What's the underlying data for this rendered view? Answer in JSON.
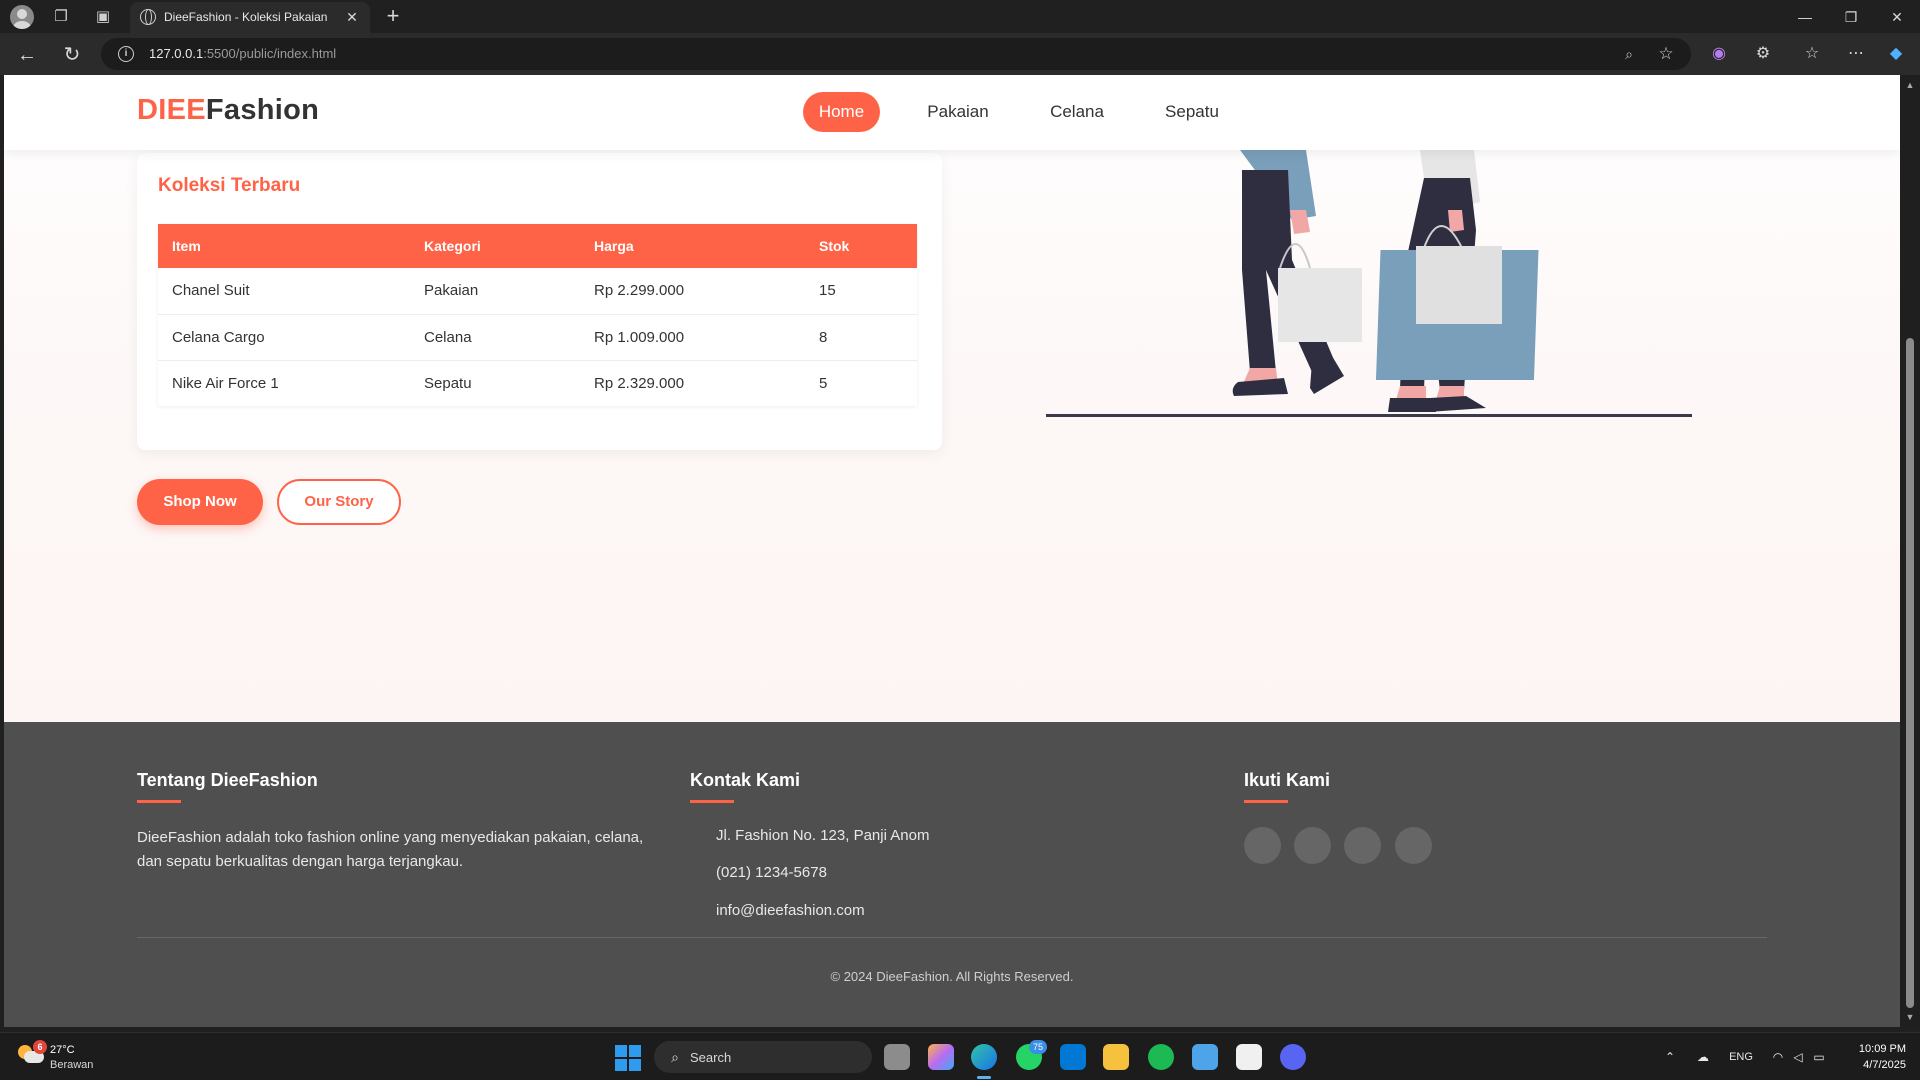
{
  "browser": {
    "tab_title": "DieeFashion - Koleksi Pakaian",
    "url_host": "127.0.0.1",
    "url_rest": ":5500/public/index.html"
  },
  "site": {
    "logo_accent": "DIEE",
    "logo_rest": "Fashion",
    "accent_color": "#ff6347",
    "nav": [
      "Home",
      "Pakaian",
      "Celana",
      "Sepatu"
    ],
    "nav_active": "Home"
  },
  "collection": {
    "title": "Koleksi Terbaru",
    "columns": [
      "Item",
      "Kategori",
      "Harga",
      "Stok"
    ],
    "rows": [
      [
        "Chanel Suit",
        "Pakaian",
        "Rp 2.299.000",
        "15"
      ],
      [
        "Celana Cargo",
        "Celana",
        "Rp 1.009.000",
        "8"
      ],
      [
        "Nike Air Force 1",
        "Sepatu",
        "Rp 2.329.000",
        "5"
      ]
    ]
  },
  "cta": {
    "primary": "Shop Now",
    "secondary": "Our Story"
  },
  "footer": {
    "about_title": "Tentang DieeFashion",
    "about_text": "DieeFashion adalah toko fashion online yang menyediakan pakaian, celana, dan sepatu berkualitas dengan harga terjangkau.",
    "contact_title": "Kontak Kami",
    "contact_address": "Jl. Fashion No. 123, Panji Anom",
    "contact_phone": "(021) 1234-5678",
    "contact_email": "info@dieefashion.com",
    "follow_title": "Ikuti Kami",
    "copyright": "© 2024 DieeFashion. All Rights Reserved."
  },
  "taskbar": {
    "temp": "27°C",
    "condition": "Berawan",
    "weather_badge": "6",
    "search_label": "Search",
    "whatsapp_badge": "75",
    "language": "ENG",
    "time": "10:09 PM",
    "date": "4/7/2025"
  }
}
